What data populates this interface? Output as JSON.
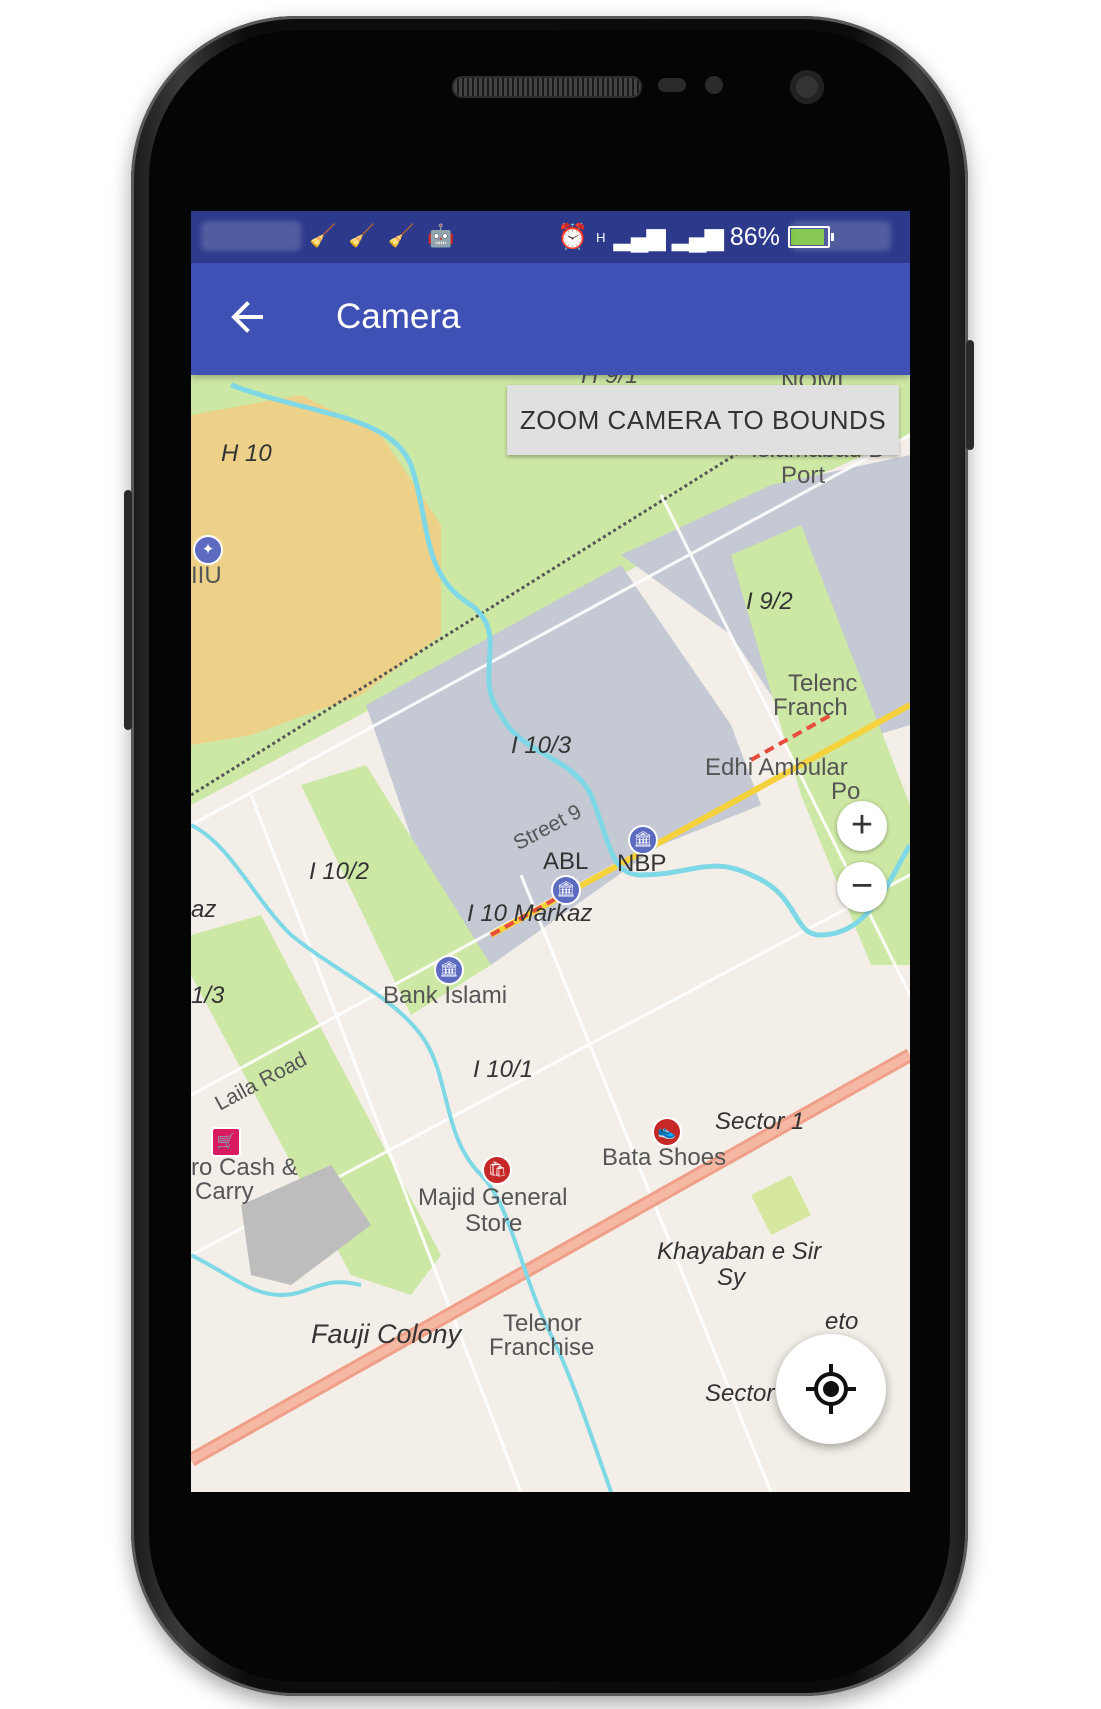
{
  "status_bar": {
    "battery_percent": "86%",
    "network_type": "H",
    "battery_level": 0.86,
    "battery_color": "#6fbf2f",
    "icons": [
      "cleaner-icon",
      "cleaner-icon",
      "cleaner-icon",
      "android-icon",
      "alarm-icon",
      "signal-icon",
      "signal-icon",
      "battery-charging-icon"
    ]
  },
  "toolbar": {
    "title": "Camera",
    "back_icon": "arrow-back-icon",
    "color": "#3f51b5"
  },
  "map": {
    "zoom_to_bounds_label": "ZOOM CAMERA TO BOUNDS",
    "zoom_in_label": "+",
    "zoom_out_label": "−",
    "labels": {
      "h10": "H 10",
      "iiu": "IIU",
      "i92": "I 9/2",
      "telenor_top_1": "Telenc",
      "telenor_top_2": "Franch",
      "i103": "I 10/3",
      "edhi_1": "Edhi Ambular",
      "edhi_2": "Po",
      "street9": "Street 9",
      "abl": "ABL",
      "nbp": "NBP",
      "i102": "I 10/2",
      "az": "az",
      "markaz": "I 10 Markaz",
      "bank_islami": "Bank Islami",
      "slash3": "1/3",
      "i101": "I 10/1",
      "laila_road": "Laila Road",
      "sector1": "Sector 1",
      "bata": "Bata Shoes",
      "cash_1": "ro Cash &",
      "cash_2": "Carry",
      "majid_1": "Majid General",
      "majid_2": "Store",
      "khayaban_1": "Khayaban e Sir",
      "khayaban_2": "Sy",
      "fauji": "Fauji Colony",
      "telenor_bottom_1": "Telenor",
      "telenor_bottom_2": "Franchise",
      "sector3": "Sector 3",
      "top_partial": "H 9/1",
      "nomi": "NOMI",
      "islamabad_port_1": "Islamabad D",
      "islamabad_port_2": "Port",
      "eto": "eto"
    }
  }
}
